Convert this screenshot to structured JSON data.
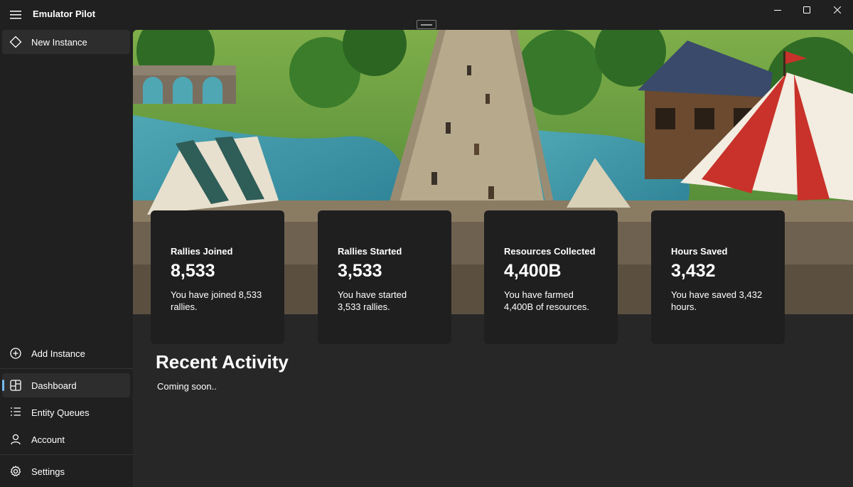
{
  "app": {
    "title": "Emulator Pilot"
  },
  "sidebar": {
    "top_items": [
      {
        "label": "New Instance",
        "icon": "diamond-icon"
      }
    ],
    "bottom_items": [
      {
        "label": "Add Instance",
        "icon": "add-circle-icon"
      },
      {
        "label": "Dashboard",
        "icon": "dashboard-icon",
        "active": true
      },
      {
        "label": "Entity Queues",
        "icon": "list-icon"
      },
      {
        "label": "Account",
        "icon": "person-icon"
      },
      {
        "label": "Settings",
        "icon": "gear-icon"
      }
    ]
  },
  "stats": [
    {
      "title": "Rallies Joined",
      "value": "8,533",
      "desc": "You have joined 8,533 rallies."
    },
    {
      "title": "Rallies Started",
      "value": "3,533",
      "desc": "You have started 3,533 rallies."
    },
    {
      "title": "Resources Collected",
      "value": "4,400B",
      "desc": "You have farmed 4,400B of resources."
    },
    {
      "title": "Hours Saved",
      "value": "3,432",
      "desc": "You have saved 3,432 hours."
    }
  ],
  "activity": {
    "title": "Recent Activity",
    "body": "Coming soon.."
  },
  "colors": {
    "accent": "#76b9ed",
    "background": "#202020",
    "card": "#1f1f1f"
  }
}
